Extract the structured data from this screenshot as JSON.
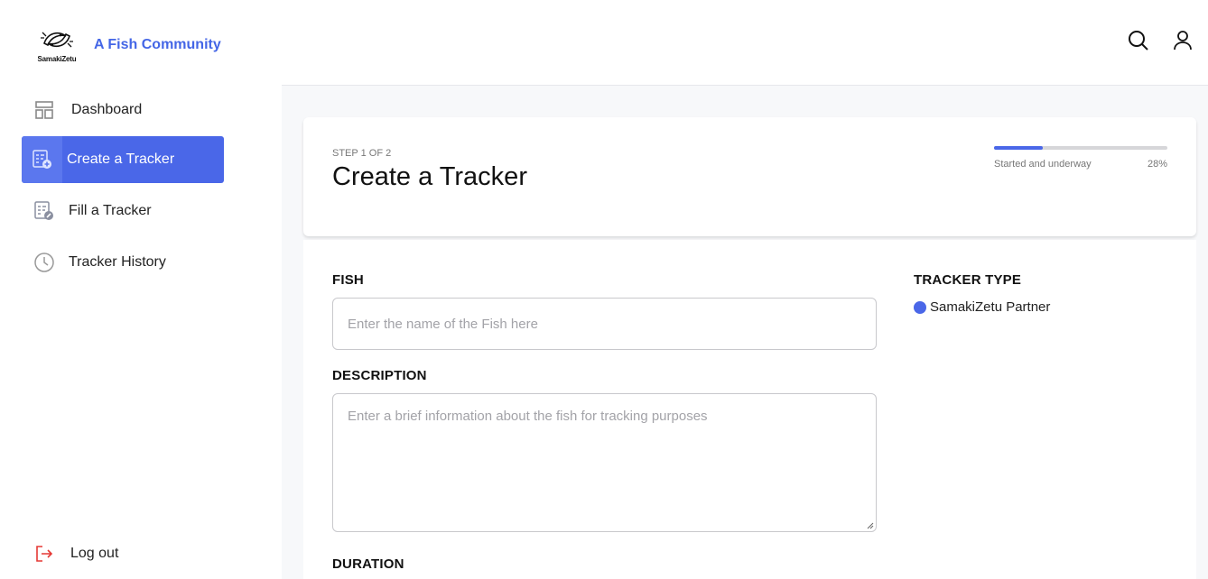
{
  "brand": {
    "logo_text": "SamakiZetu",
    "title": "A Fish Community",
    "accent": "#4a67e8"
  },
  "nav": {
    "items": [
      {
        "label": "Dashboard",
        "icon": "dashboard-icon"
      },
      {
        "label": "Create a Tracker",
        "icon": "create-tracker-icon",
        "active": true
      },
      {
        "label": "Fill a Tracker",
        "icon": "fill-tracker-icon"
      },
      {
        "label": "Tracker History",
        "icon": "history-icon"
      }
    ],
    "logout_label": "Log out"
  },
  "header": {
    "search_icon": "search-icon",
    "user_icon": "user-icon"
  },
  "tracker": {
    "step": "STEP 1 OF 2",
    "title": "Create a Tracker",
    "progress_label": "Started and underway",
    "progress_text": "28%",
    "progress_value": 0.28
  },
  "form": {
    "fish_label": "FISH",
    "fish_placeholder": "Enter the name of the Fish here",
    "description_label": "DESCRIPTION",
    "description_placeholder": "Enter a brief information about the fish for tracking purposes",
    "duration_label": "DURATION",
    "type_label": "TRACKER TYPE",
    "type_option": "SamakiZetu Partner"
  }
}
